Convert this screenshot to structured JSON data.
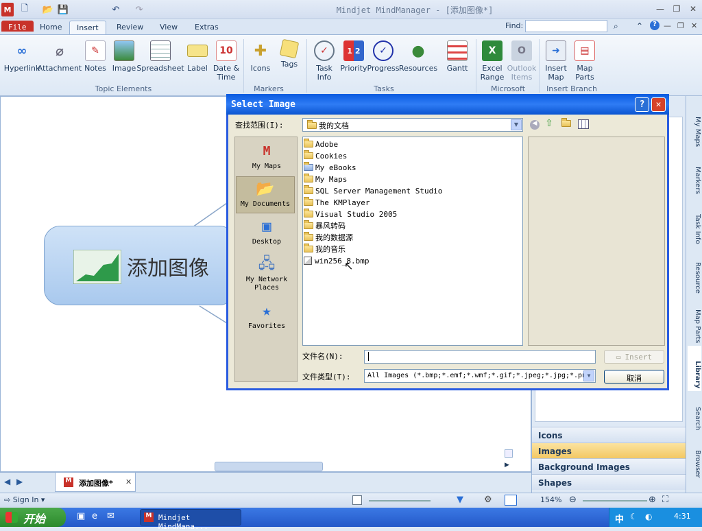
{
  "app": {
    "title": "Mindjet MindManager - [添加图像*]"
  },
  "quick_access": {
    "new": "🗋",
    "open": "📂",
    "save": "💾",
    "undo": "↶",
    "redo": "↷"
  },
  "ribbon_tabs": [
    "File",
    "Home",
    "Insert",
    "Review",
    "View",
    "Extras"
  ],
  "find": {
    "label": "Find:",
    "value": ""
  },
  "ribbon": {
    "topic_elements": {
      "group": "Topic Elements",
      "buttons": [
        "Hyperlink",
        "Attachment",
        "Notes",
        "Image",
        "Spreadsheet",
        "Label",
        "Date &\nTime"
      ]
    },
    "markers": {
      "group": "Markers",
      "buttons": [
        "Icons",
        "Tags"
      ]
    },
    "tasks": {
      "group": "Tasks",
      "buttons": [
        "Task\nInfo",
        "Priority",
        "Progress",
        "Resources",
        "Gantt"
      ]
    },
    "office": {
      "group": "Microsoft Office",
      "buttons": [
        "Excel\nRange",
        "Outlook\nItems"
      ]
    },
    "branch": {
      "group": "Insert Branch",
      "buttons": [
        "Insert\nMap",
        "Map\nParts"
      ]
    }
  },
  "topic": {
    "label": "添加图像"
  },
  "dialog": {
    "title": "Select Image",
    "look_in_label": "查找范围(I):",
    "look_in_value": "我的文档",
    "places": [
      "My Maps",
      "My Documents",
      "Desktop",
      "My Network\nPlaces",
      "Favorites"
    ],
    "files": [
      "Adobe",
      "Cookies",
      "My eBooks",
      "My Maps",
      "SQL Server Management Studio",
      "The KMPlayer",
      "Visual Studio 2005",
      "暴风转码",
      "我的数据源",
      "我的音乐",
      "win256_8.bmp"
    ],
    "filename_label": "文件名(N):",
    "filename_value": "",
    "filetype_label": "文件类型(T):",
    "filetype_value": "All Images (*.bmp;*.emf;*.wmf;*.gif;*.jpeg;*.jpg;*.png",
    "insert_button": "Insert",
    "cancel_button": "取消"
  },
  "library_panel": {
    "items": [
      "Icons",
      "Images",
      "Background Images",
      "Shapes"
    ],
    "active": "Images"
  },
  "side_tabs": [
    "My Maps",
    "Markers",
    "Task Info",
    "Resource",
    "Map Parts",
    "Library",
    "Search",
    "Browser"
  ],
  "doc_tab": {
    "label": "添加图像*"
  },
  "status": {
    "sign_in": "Sign In",
    "zoom": "154%"
  },
  "taskbar": {
    "start": "开始",
    "task": "Mindjet MindMana...",
    "time": "4:31",
    "ime": "中"
  }
}
